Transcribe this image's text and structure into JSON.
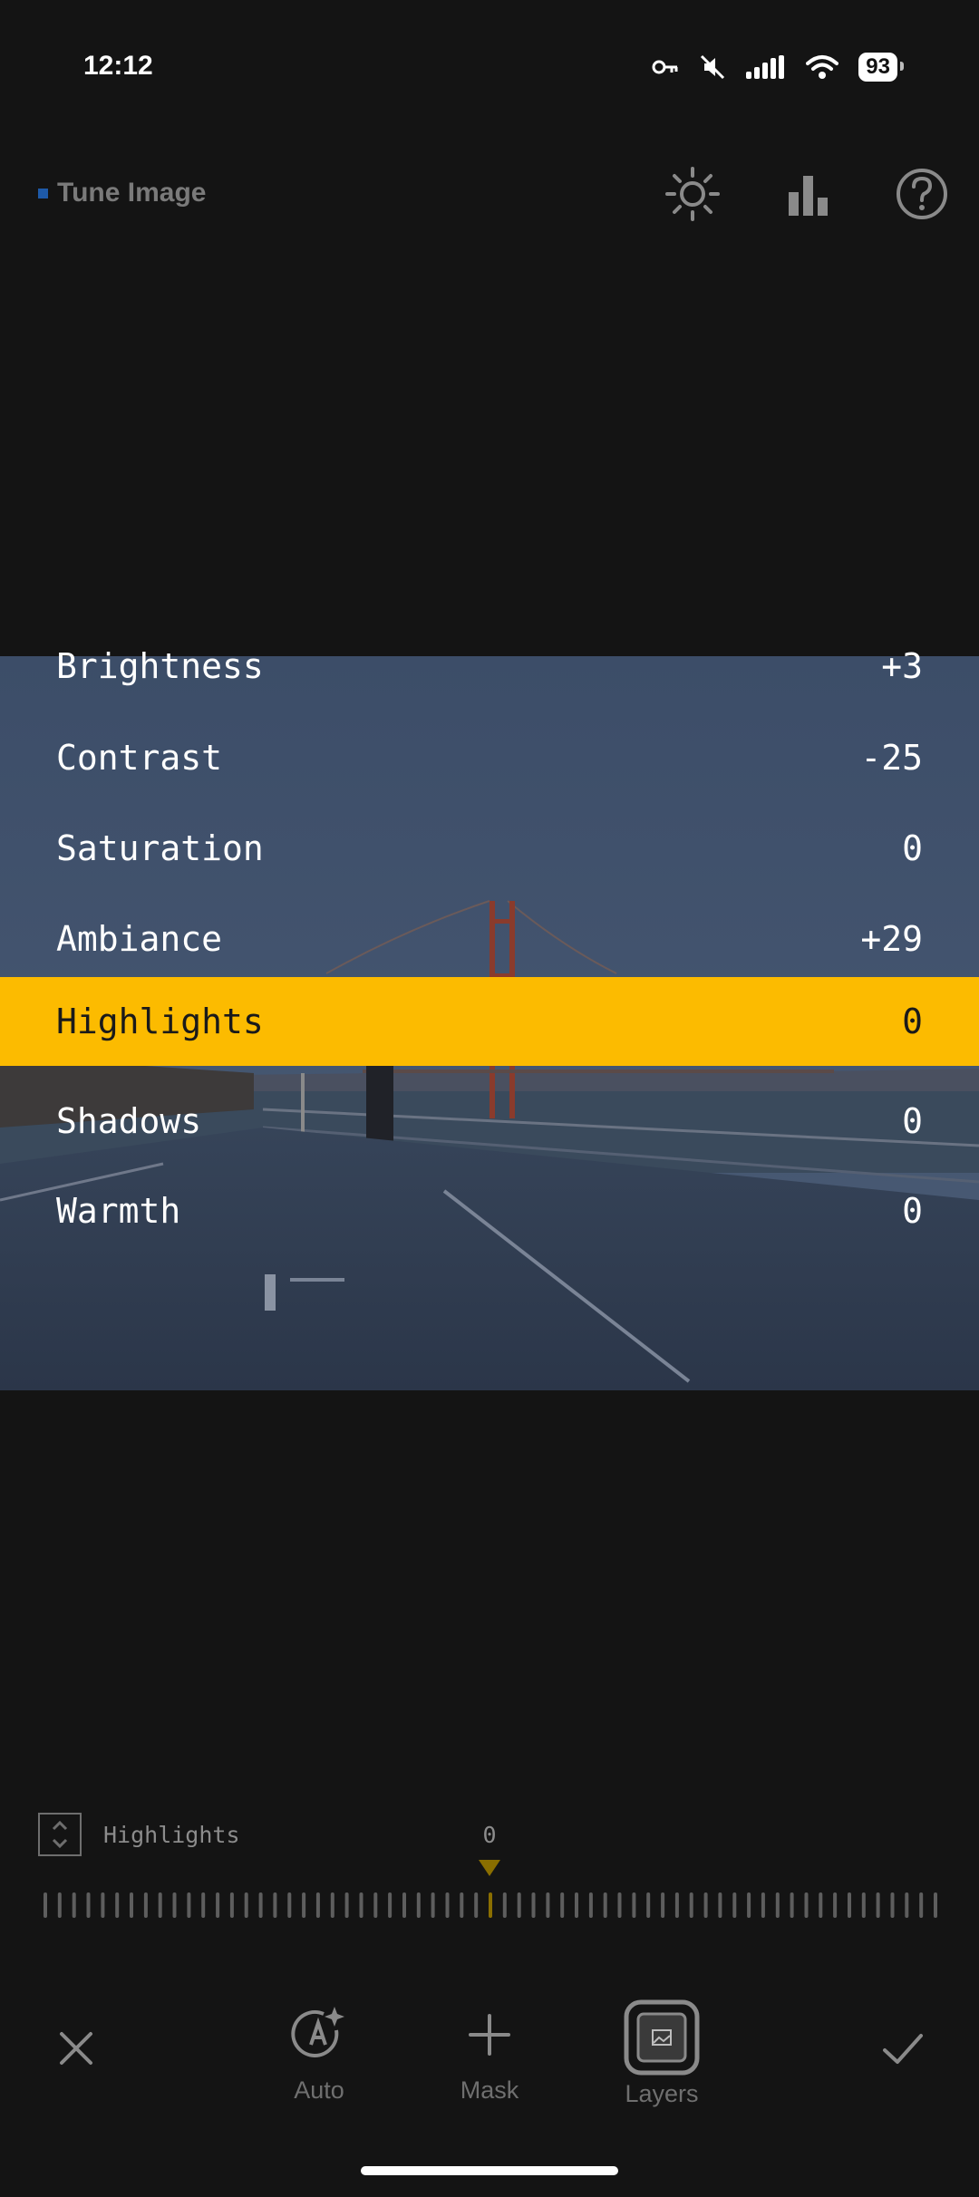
{
  "status_bar": {
    "time": "12:12",
    "battery": "93"
  },
  "header": {
    "title": "Tune Image",
    "accent_color": "#1e5aa8",
    "icons": [
      "brightness-icon",
      "histogram-icon",
      "help-icon"
    ]
  },
  "adjustments": [
    {
      "label": "Brightness",
      "value": "+3"
    },
    {
      "label": "Contrast",
      "value": "-25"
    },
    {
      "label": "Saturation",
      "value": "0"
    },
    {
      "label": "Ambiance",
      "value": "+29"
    },
    {
      "label": "Highlights",
      "value": "0",
      "selected": true
    },
    {
      "label": "Shadows",
      "value": "0"
    },
    {
      "label": "Warmth",
      "value": "0"
    }
  ],
  "highlight_color": "#fcbb00",
  "slider": {
    "parameter_label": "Highlights",
    "value": "0",
    "position_fraction": 0.5
  },
  "toolbar": {
    "cancel_icon": "close-icon",
    "auto_label": "Auto",
    "mask_label": "Mask",
    "layers_label": "Layers",
    "confirm_icon": "checkmark-icon"
  }
}
